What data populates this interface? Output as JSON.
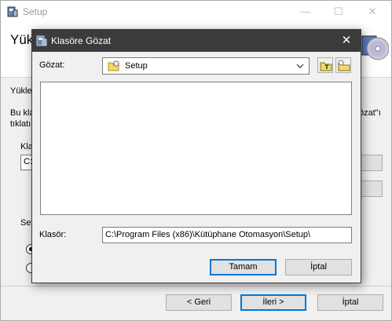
{
  "setup": {
    "title": "Setup",
    "heading": "Yük",
    "label_1": "Yükle",
    "label_2a": "Bu kla",
    "label_2b": "tıklatın",
    "label_2c": "özat\"ı",
    "label_3": "Kla",
    "input_value": "C:",
    "label_4": "Set",
    "back_label": "< Geri",
    "next_label": "İleri >",
    "cancel_label": "İptal"
  },
  "dialog": {
    "title": "Klasöre Gözat",
    "look_in_label": "Gözat:",
    "look_in_value": "Setup",
    "folder_label": "Klasör:",
    "folder_path": "C:\\Program Files (x86)\\Kütüphane Otomasyon\\Setup\\",
    "ok_label": "Tamam",
    "cancel_label": "İptal"
  },
  "colors": {
    "dialog_titlebar": "#3b3b3b",
    "default_button_border": "#0078d7",
    "window_bg": "#f0f0f0"
  },
  "icons": [
    "setup-app-icon",
    "cd-icon",
    "close-icon",
    "minimize-icon",
    "maximize-icon",
    "folder-icon",
    "chevron-down-icon",
    "up-folder-icon",
    "new-folder-icon"
  ]
}
